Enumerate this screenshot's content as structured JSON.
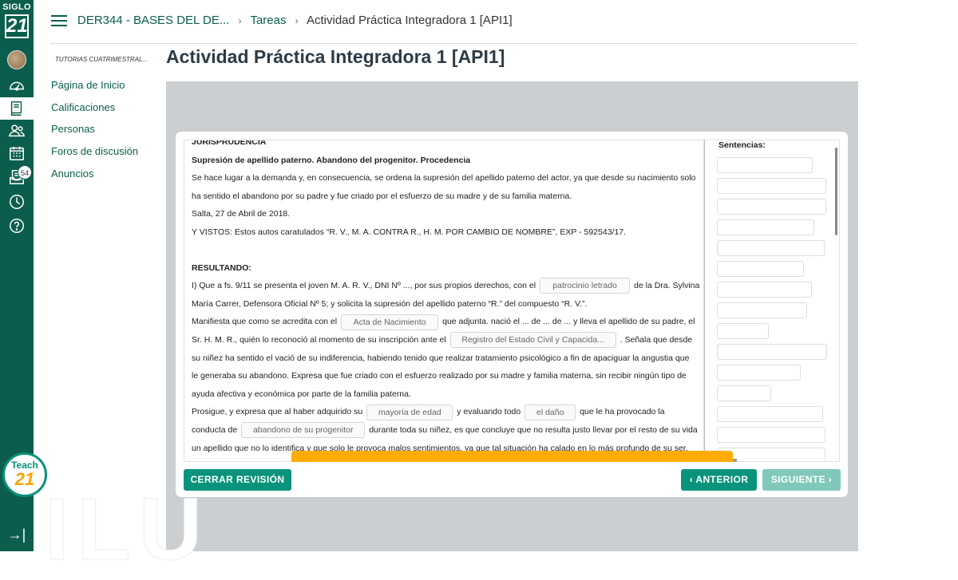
{
  "global_nav": {
    "logo_top": "SIGLO",
    "logo_num": "21",
    "items": [
      {
        "name": "dashboard",
        "icon": "dashboard-icon"
      },
      {
        "name": "courses",
        "icon": "book-icon",
        "active": true
      },
      {
        "name": "groups",
        "icon": "people-icon"
      },
      {
        "name": "calendar",
        "icon": "calendar-icon"
      },
      {
        "name": "inbox",
        "icon": "inbox-icon",
        "badge": "54"
      },
      {
        "name": "history",
        "icon": "clock-icon"
      },
      {
        "name": "help",
        "icon": "help-icon"
      }
    ],
    "teach_label": "Teach",
    "teach_num": "21",
    "collapse_icon": "collapse-icon"
  },
  "header": {
    "course": "DER344 - BASES DEL DE...",
    "crumb2": "Tareas",
    "crumb3": "Actividad Práctica Integradora 1 [API1]",
    "sep": "›"
  },
  "course_nav": {
    "subtitle": "TUTORIAS CUATRIMESTRAL...",
    "items": [
      "Página de Inicio",
      "Calificaciones",
      "Personas",
      "Foros de discusión",
      "Anuncios"
    ]
  },
  "page_title": "Actividad Práctica Integradora 1 [API1]",
  "document": {
    "cut_heading": "JURISPRUDENCIA",
    "title": "Supresión de apellido paterno. Abandono del progenitor. Procedencia",
    "p1a": "Se hace lugar a la demanda y, en consecuencia, se ordena la supresión del apellido paterno del actor, ya que desde su nacimiento solo",
    "p1b": "ha sentido el abandono por su padre y fue criado por el esfuerzo de su madre y de su familia materna.",
    "date": "Salta, 27 de Abril de 2018.",
    "vistos": "Y VISTOS: Estos autos caratulados “R. V., M. A. CONTRA R., H. M. POR CAMBIO DE NOMBRE”, EXP - 592543/17.",
    "resultando": "RESULTANDO:",
    "l1a": "I) Que a fs. 9/11 se presenta el joven M. A. R. V., DNI Nº ..., por sus propios derechos, con el",
    "blank1": "patrocinio letrado",
    "l1b": "de la Dra. Sylvina",
    "l2": "María Carrer, Defensora Oficial Nº 5; y solicita la supresión del apellido paterno “R.” del compuesto “R. V.”.",
    "l3a": "Manifiesta que como se acredita con el",
    "blank2": "Acta de Nacimiento",
    "l3b": "que adjunta. nació el ... de ... de ... y lleva el apellido de su padre, el",
    "l4a": "Sr. H. M. R., quién lo reconoció al momento de su inscripción ante el",
    "blank3": "Registro del Estado Civil y Capacida...",
    "l4b": ". Señala que desde",
    "l5": "su niñez ha sentido el vació de su indiferencia, habiendo tenido que realizar tratamiento psicológico a fin de apaciguar la angustia que",
    "l6": "le generaba su abandono. Expresa que fue criado con el esfuerzo realizado por su madre y familia materna, sin recibir ningún tipo de",
    "l7": "ayuda afectiva y económica por parte de la familia paterna.",
    "l8a": "Prosigue, y expresa que al haber adquirido su",
    "blank4": "mayoría de edad",
    "l8b": "y evaluando todo",
    "blank5": "el daño",
    "l8c": "que le ha provocado la",
    "l9a": "conducta de",
    "blank6": "abandono de su progenitor",
    "l9b": "durante toda su niñez, es que concluye que no resulta justo llevar por el resto de su vida",
    "l10": "un apellido que no lo identifica y que solo le provoca malos sentimientos, ya que tal situación ha calado en lo más profundo de su ser."
  },
  "sentences": {
    "title": "Sentencias:",
    "slot_count": 16
  },
  "buttons": {
    "close": "CERRAR REVISIÓN",
    "prev": "ANTERIOR",
    "next": "SIGUIENTE"
  }
}
